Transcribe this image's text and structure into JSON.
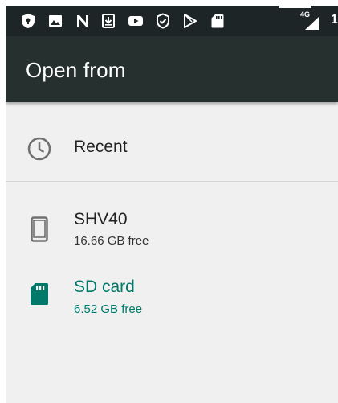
{
  "status_bar": {
    "icons": [
      "shield-icon",
      "image-icon",
      "n-logo-icon",
      "download-icon",
      "youtube-icon",
      "shield-check-icon",
      "play-store-icon",
      "sd-card-icon"
    ],
    "network_label": "4G",
    "time_partial": "1"
  },
  "app_bar": {
    "title": "Open from"
  },
  "roots": [
    {
      "icon": "clock-icon",
      "title": "Recent"
    },
    {
      "icon": "phone-icon",
      "title": "SHV40",
      "summary": "16.66 GB free"
    },
    {
      "icon": "sd-card-icon",
      "title": "SD card",
      "summary": "6.52 GB free"
    }
  ],
  "colors": {
    "status_bar": "#1d2526",
    "app_bar": "#25302f",
    "background": "#f0f0f0",
    "accent": "#00796b"
  }
}
